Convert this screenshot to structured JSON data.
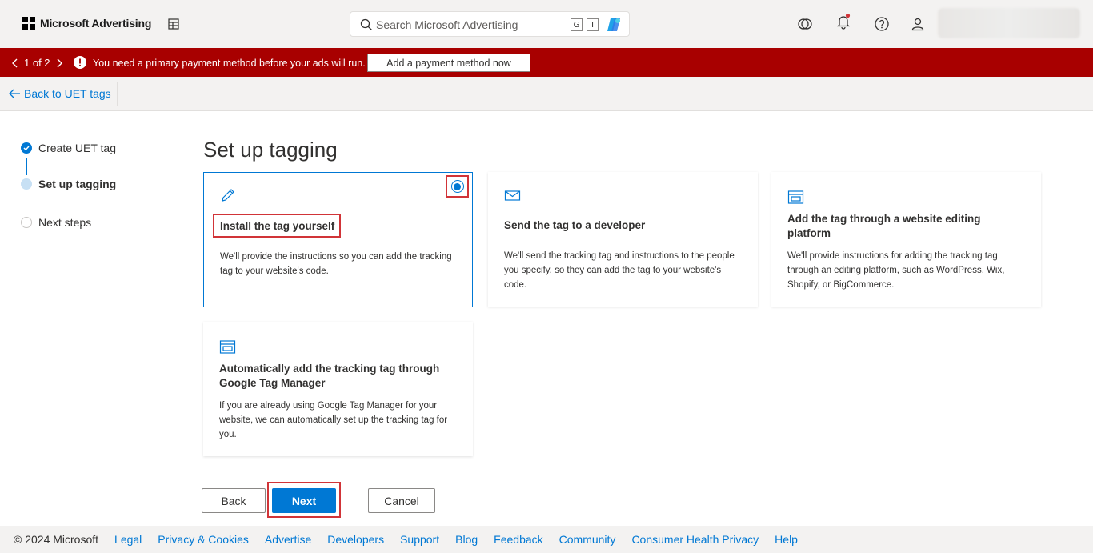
{
  "app": {
    "name": "Microsoft Advertising"
  },
  "search": {
    "placeholder": "Search Microsoft Advertising",
    "shortcut_keys": [
      "G",
      "T"
    ]
  },
  "banner": {
    "pager": "1 of 2",
    "message": "You need a primary payment method before your ads will run.",
    "action_label": "Add a payment method now"
  },
  "nav": {
    "back_label": "Back to UET tags"
  },
  "steps": [
    {
      "label": "Create UET tag",
      "state": "done"
    },
    {
      "label": "Set up tagging",
      "state": "current"
    },
    {
      "label": "Next steps",
      "state": "pending"
    }
  ],
  "page": {
    "title": "Set up tagging"
  },
  "options": [
    {
      "icon": "pencil-icon",
      "title": "Install the tag yourself",
      "desc": "We'll provide the instructions so you can add the tracking tag to your website's code.",
      "selected": true
    },
    {
      "icon": "mail-icon",
      "title": "Send the tag to a developer",
      "desc": "We'll send the tracking tag and instructions to the people you specify, so they can add the tag to your website's code.",
      "selected": false
    },
    {
      "icon": "browser-icon",
      "title": "Add the tag through a website editing platform",
      "desc": "We'll provide instructions for adding the tracking tag through an editing platform, such as WordPress, Wix, Shopify, or BigCommerce.",
      "selected": false
    },
    {
      "icon": "browser-icon",
      "title": "Automatically add the tracking tag through Google Tag Manager",
      "desc": "If you are already using Google Tag Manager for your website, we can automatically set up the tracking tag for you.",
      "selected": false
    }
  ],
  "actions": {
    "back": "Back",
    "next": "Next",
    "cancel": "Cancel"
  },
  "footer": {
    "copyright": "© 2024 Microsoft",
    "links": [
      "Legal",
      "Privacy & Cookies",
      "Advertise",
      "Developers",
      "Support",
      "Blog",
      "Feedback",
      "Community",
      "Consumer Health Privacy",
      "Help"
    ]
  },
  "colors": {
    "accent": "#0078d4",
    "banner": "#a80000",
    "highlight": "#d13438"
  }
}
